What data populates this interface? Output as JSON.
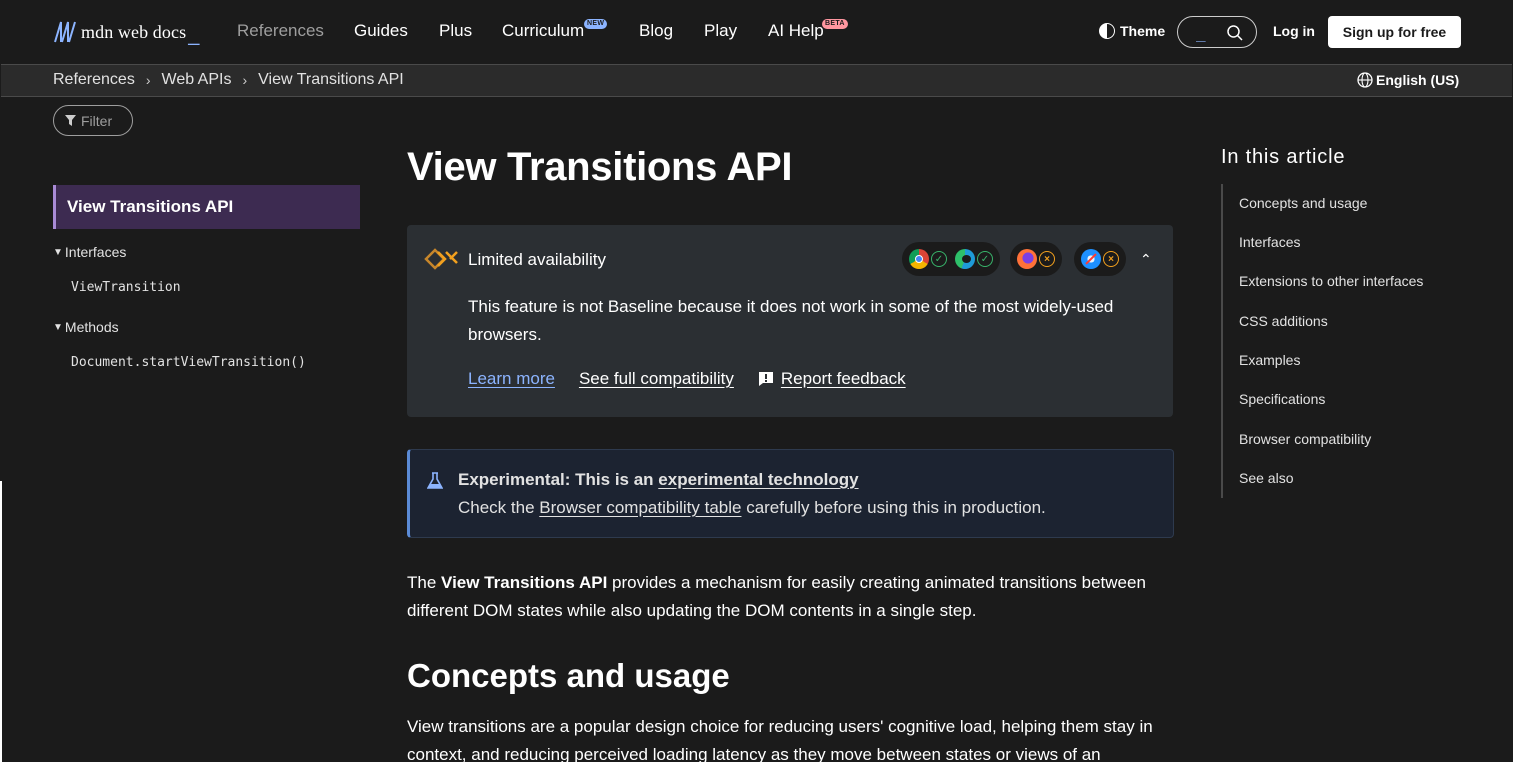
{
  "header": {
    "logo_text": "mdn web docs",
    "logo_cursor": "_",
    "nav": {
      "references": "References",
      "guides": "Guides",
      "plus": "Plus",
      "curriculum": "Curriculum",
      "blog": "Blog",
      "play": "Play",
      "ai_help": "AI Help"
    },
    "badges": {
      "new": "NEW",
      "beta": "BETA"
    },
    "theme_label": "Theme",
    "search_placeholder": "_",
    "login_label": "Log in",
    "signup_label": "Sign up for free"
  },
  "breadcrumb": {
    "items": [
      "References",
      "Web APIs",
      "View Transitions API"
    ],
    "separator": "›",
    "language": "English (US)"
  },
  "sidebar": {
    "filter_placeholder": "Filter",
    "active_item": "View Transitions API",
    "groups": [
      {
        "label": "Interfaces",
        "items": [
          "ViewTransition"
        ]
      },
      {
        "label": "Methods",
        "items": [
          "Document.startViewTransition()"
        ]
      }
    ]
  },
  "main": {
    "title": "View Transitions API",
    "availability": {
      "title": "Limited availability",
      "description": "This feature is not Baseline because it does not work in some of the most widely-used browsers.",
      "links": {
        "learn_more": "Learn more",
        "compat": "See full compatibility",
        "feedback": "Report feedback"
      },
      "browsers": [
        {
          "name": "chrome-icon",
          "status": "✓"
        },
        {
          "name": "edge-icon",
          "status": "✓"
        },
        {
          "name": "firefox-icon",
          "status": "×"
        },
        {
          "name": "safari-icon",
          "status": "×"
        }
      ]
    },
    "experimental": {
      "prefix": "Experimental: This is an ",
      "link": "experimental technology",
      "line2_pre": "Check the ",
      "line2_link": "Browser compatibility table",
      "line2_post": " carefully before using this in production."
    },
    "intro": {
      "pre": "The ",
      "bold": "View Transitions API",
      "post": " provides a mechanism for easily creating animated transitions between different DOM states while also updating the DOM contents in a single step."
    },
    "section_title": "Concepts and usage",
    "section_para": "View transitions are a popular design choice for reducing users' cognitive load, helping them stay in context, and reducing perceived loading latency as they move between states or views of an"
  },
  "toc": {
    "title": "In this article",
    "items": [
      "Concepts and usage",
      "Interfaces",
      "Extensions to other interfaces",
      "CSS additions",
      "Examples",
      "Specifications",
      "Browser compatibility",
      "See also"
    ]
  },
  "colors": {
    "background": "#1b1b1b",
    "accent_blue": "#8cb4ff",
    "sidebar_active": "#3d2b51",
    "ok_green": "#38b36a",
    "warn_orange": "#f2a01e"
  }
}
